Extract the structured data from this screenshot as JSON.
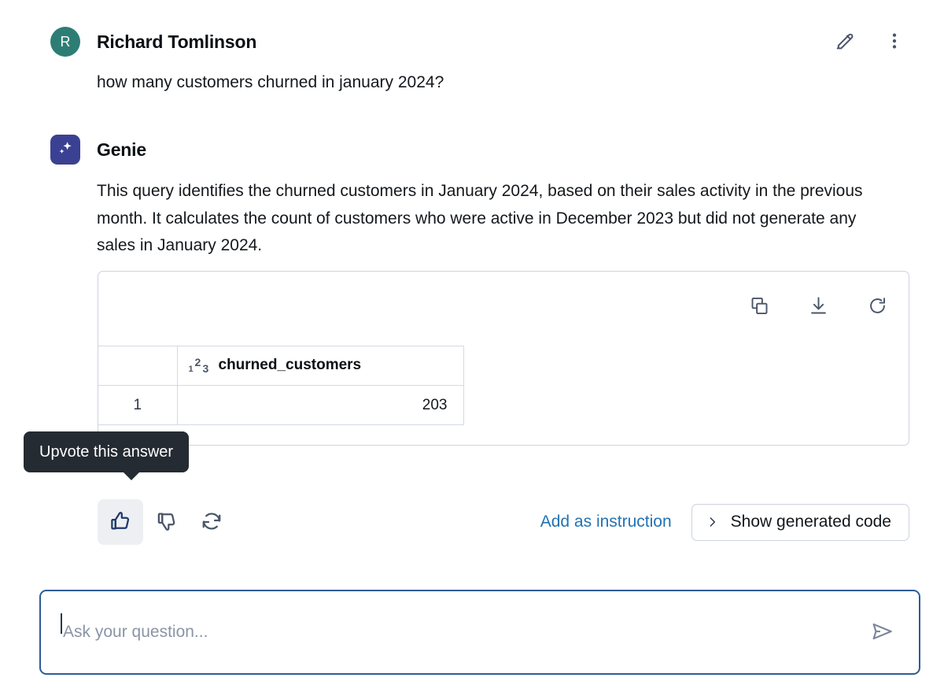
{
  "user_message": {
    "avatar_initial": "R",
    "avatar_color": "#2E7D74",
    "author": "Richard Tomlinson",
    "text": "how many customers churned in january 2024?",
    "actions": {
      "edit_label": "Edit",
      "more_label": "More options"
    }
  },
  "genie_message": {
    "author": "Genie",
    "badge_color": "#3B4192",
    "text": "This query identifies the churned customers in January 2024, based on their sales activity in the previous month. It calculates the count of customers who were active in December 2023 but did not generate any sales in January 2024."
  },
  "result_card": {
    "toolbar": {
      "copy_label": "Copy",
      "download_label": "Download",
      "refresh_label": "Refresh"
    },
    "table": {
      "type_icon": {
        "n1": "1",
        "n2": "2",
        "n3": "3"
      },
      "columns": [
        "churned_customers"
      ],
      "rows": [
        {
          "index": "1",
          "values": [
            "203"
          ]
        }
      ]
    }
  },
  "tooltip": {
    "text": "Upvote this answer"
  },
  "feedback": {
    "upvote_label": "Upvote",
    "downvote_label": "Downvote",
    "regenerate_label": "Regenerate",
    "add_instruction_label": "Add as instruction",
    "show_code_label": "Show generated code",
    "upvote_active": true,
    "active_bg": "#EDEFF3",
    "active_color": "#1F3A68",
    "link_color": "#2272B4"
  },
  "composer": {
    "placeholder": "Ask your question...",
    "value": "",
    "send_label": "Send",
    "focus_border": "#2F5C96"
  }
}
